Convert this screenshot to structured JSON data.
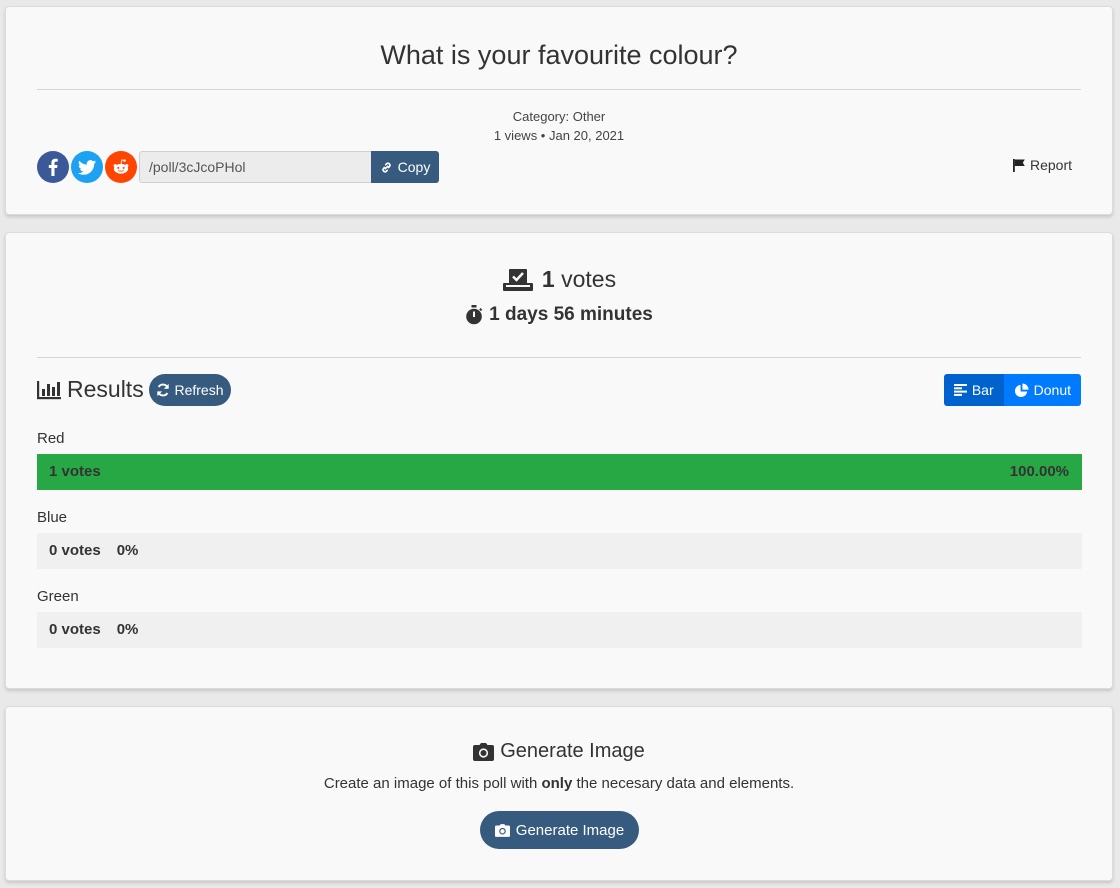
{
  "poll": {
    "title": "What is your favourite colour?",
    "category": "Category: Other",
    "meta": "1 views • Jan 20, 2021",
    "share_path": "/poll/3cJcoPHol",
    "copy_label": "Copy",
    "report_label": "Report"
  },
  "social": [
    {
      "name": "facebook",
      "glyph": "f",
      "color": "#3b5998"
    },
    {
      "name": "twitter",
      "glyph": "t",
      "color": "#1da1f2"
    },
    {
      "name": "reddit",
      "glyph": "r",
      "color": "#ff4500"
    }
  ],
  "stats": {
    "votes_count": "1",
    "votes_word": "votes",
    "time_left": "1 days 56 minutes"
  },
  "results": {
    "heading": "Results",
    "refresh_label": "Refresh",
    "view_bar_label": "Bar",
    "view_donut_label": "Donut",
    "options": [
      {
        "label": "Red",
        "votes_text": "1 votes",
        "percent_text": "100.00%",
        "percent": 100,
        "color": "#28a745"
      },
      {
        "label": "Blue",
        "votes_text": "0 votes",
        "percent_text": "0%",
        "percent": 0,
        "color": "#28a745"
      },
      {
        "label": "Green",
        "votes_text": "0 votes",
        "percent_text": "0%",
        "percent": 0,
        "color": "#28a745"
      }
    ]
  },
  "generate": {
    "title": "Generate Image",
    "desc_before": "Create an image of this poll with ",
    "desc_bold": "only",
    "desc_after": " the necesary data and elements.",
    "button_label": "Generate Image"
  },
  "colors": {
    "primary": "#375a7f",
    "bar_toggle_active": "#0062cc",
    "bar_toggle": "#007bff",
    "bar_fill": "#28a745"
  }
}
